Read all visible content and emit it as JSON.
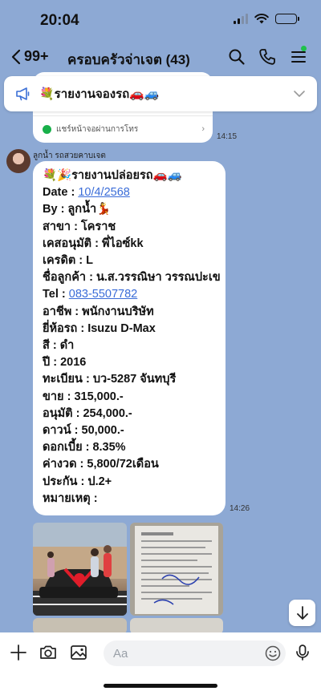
{
  "status": {
    "time": "20:04"
  },
  "header": {
    "back_count": "99+",
    "title": "ครอบครัวจ่าเจต (43)"
  },
  "announcement": {
    "text": "💐รายงานจองรถ🚗🚙"
  },
  "prev_message": {
    "share_text": "แชร์หน้าจอผ่านการโทร",
    "time": "14:15"
  },
  "sender": {
    "name": "ลูกน้ำ รถสวยคาบเจต"
  },
  "message": {
    "time": "14:26",
    "lines": [
      {
        "key": "",
        "val": "💐🎉รายงานปล่อยรถ🚗🚙"
      },
      {
        "key": "Date : ",
        "val": "10/4/2568"
      },
      {
        "key": "By : ",
        "val": "ลูกน้ำ💃"
      },
      {
        "key": "สาขา : ",
        "val": "โคราช"
      },
      {
        "key": "เคสอนุมัติ : ",
        "val": "พี่ไอซ์kk"
      },
      {
        "key": "เครดิต : ",
        "val": "L"
      },
      {
        "key": "ชื่อลูกค้า : ",
        "val": "น.ส.วรรณิษา วรรณปะเข"
      },
      {
        "key": "Tel : ",
        "val": "083-5507782"
      },
      {
        "key": "อาชีพ : ",
        "val": "พนักงานบริษัท"
      },
      {
        "key": "ยี่ห้อรถ : ",
        "val": "Isuzu D-Max"
      },
      {
        "key": "สี : ",
        "val": "ดำ"
      },
      {
        "key": "ปี : ",
        "val": "2016"
      },
      {
        "key": "ทะเบียน : ",
        "val": "บว-5287 จันทบุรี"
      },
      {
        "key": "ขาย : ",
        "val": "315,000.-"
      },
      {
        "key": "อนุมัติ : ",
        "val": "254,000.-"
      },
      {
        "key": "ดาวน์ : ",
        "val": "50,000.-"
      },
      {
        "key": "ดอกเบี้ย : ",
        "val": "8.35%"
      },
      {
        "key": "ค่างวด : ",
        "val": "5,800/72เดือน"
      },
      {
        "key": "ประกัน : ",
        "val": "ป.2+"
      },
      {
        "key": "หมายเหตุ : ",
        "val": ""
      }
    ]
  },
  "input": {
    "placeholder": "Aa"
  },
  "colors": {
    "chat_bg": "#8da9d4",
    "link": "#3a6cd8",
    "online_dot": "#1ec24a"
  }
}
